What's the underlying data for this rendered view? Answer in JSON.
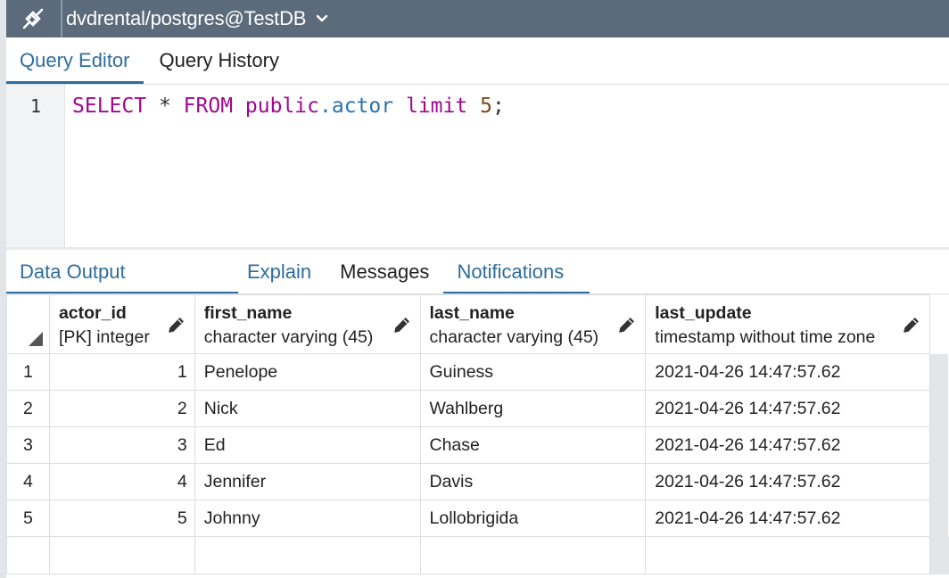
{
  "connection": {
    "icon": "plug-icon",
    "title": "dvdrental/postgres@TestDB"
  },
  "editor_tabs": [
    {
      "label": "Query Editor",
      "active": true
    },
    {
      "label": "Query History",
      "active": false
    }
  ],
  "editor": {
    "line_number": "1",
    "tokens": {
      "select": "SELECT",
      "star": "*",
      "from": "FROM",
      "schema": "public",
      "dot": ".",
      "table": "actor",
      "limit": "limit",
      "count": "5",
      "semi": ";"
    }
  },
  "result_tabs": [
    {
      "label": "Data Output",
      "active": true
    },
    {
      "label": "Explain",
      "active": false
    },
    {
      "label": "Messages",
      "active": false
    },
    {
      "label": "Notifications",
      "active": true
    }
  ],
  "grid": {
    "columns": [
      {
        "name": "actor_id",
        "type": "[PK] integer"
      },
      {
        "name": "first_name",
        "type": "character varying (45)"
      },
      {
        "name": "last_name",
        "type": "character varying (45)"
      },
      {
        "name": "last_update",
        "type": "timestamp without time zone"
      }
    ],
    "rows": [
      {
        "n": "1",
        "actor_id": "1",
        "first_name": "Penelope",
        "last_name": "Guiness",
        "last_update": "2021-04-26 14:47:57.62"
      },
      {
        "n": "2",
        "actor_id": "2",
        "first_name": "Nick",
        "last_name": "Wahlberg",
        "last_update": "2021-04-26 14:47:57.62"
      },
      {
        "n": "3",
        "actor_id": "3",
        "first_name": "Ed",
        "last_name": "Chase",
        "last_update": "2021-04-26 14:47:57.62"
      },
      {
        "n": "4",
        "actor_id": "4",
        "first_name": "Jennifer",
        "last_name": "Davis",
        "last_update": "2021-04-26 14:47:57.62"
      },
      {
        "n": "5",
        "actor_id": "5",
        "first_name": "Johnny",
        "last_name": "Lollobrigida",
        "last_update": "2021-04-26 14:47:57.62"
      }
    ]
  },
  "colors": {
    "topbar": "#5b6b7c",
    "accent": "#2d6d9e",
    "keyword": "#a0098f"
  }
}
